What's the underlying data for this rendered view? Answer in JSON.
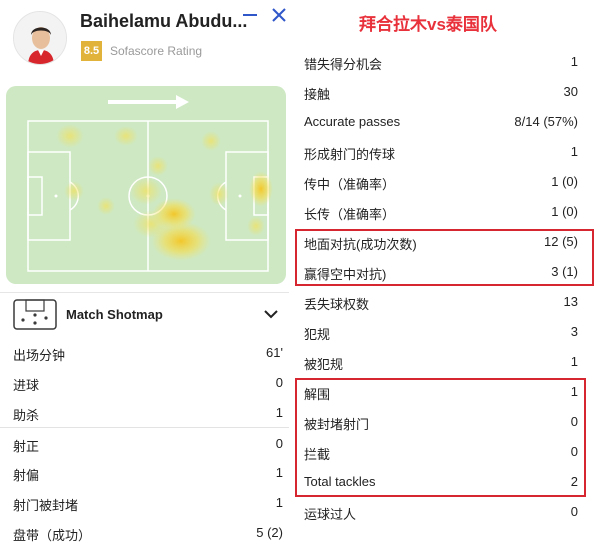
{
  "player": {
    "name": "Baihelamu Abudu...",
    "rating": "8.5",
    "rating_label": "Sofascore Rating"
  },
  "shotmap": {
    "title": "Match Shotmap"
  },
  "left_stats": [
    {
      "label": "出场分钟",
      "value": "61'"
    },
    {
      "label": "进球",
      "value": "0"
    },
    {
      "label": "助杀",
      "value": "1"
    },
    {
      "label": "射正",
      "value": "0"
    },
    {
      "label": "射偏",
      "value": "1"
    },
    {
      "label": "射门被封堵",
      "value": "1"
    },
    {
      "label": "盘带（成功）",
      "value": "5 (2)"
    }
  ],
  "match_title": "拜合拉木vs泰国队",
  "right_stats": [
    {
      "label": "错失得分机会",
      "value": "1"
    },
    {
      "label": "接触",
      "value": "30"
    },
    {
      "label": "Accurate passes",
      "value": "8/14 (57%)"
    },
    {
      "label": "形成射门的传球",
      "value": "1"
    },
    {
      "label": "传中（准确率）",
      "value": "1 (0)"
    },
    {
      "label": "长传（准确率）",
      "value": "1 (0)"
    },
    {
      "label": "地面对抗(成功次数)",
      "value": "12 (5)"
    },
    {
      "label": "赢得空中对抗)",
      "value": "3 (1)"
    },
    {
      "label": "丢失球权数",
      "value": "13"
    },
    {
      "label": "犯规",
      "value": "3"
    },
    {
      "label": "被犯规",
      "value": "1"
    },
    {
      "label": "解围",
      "value": "1"
    },
    {
      "label": "被封堵射门",
      "value": "0"
    },
    {
      "label": "拦截",
      "value": "0"
    },
    {
      "label": "Total tackles",
      "value": "2"
    },
    {
      "label": "运球过人",
      "value": "0"
    }
  ],
  "colors": {
    "pitch": "#cde8c3",
    "pitch_lines": "#ffffff",
    "heat": "#f2d23a",
    "highlight": "#d6262f",
    "title": "#e8313b",
    "rating": "#e2b33b",
    "close_icon": "#2f57c9"
  },
  "icons": [
    "minimize-icon",
    "close-icon",
    "attack-direction-arrow-icon",
    "shotmap-icon",
    "chevron-down-icon"
  ]
}
